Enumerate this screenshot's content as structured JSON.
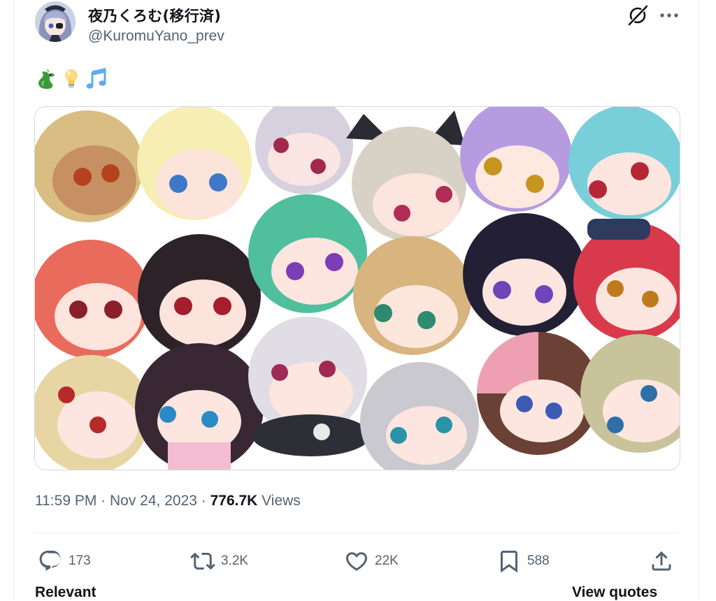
{
  "author": {
    "display_name": "夜乃くろむ(移行済)",
    "handle": "@KuromuYano_prev",
    "avatar_icon": "avatar-image"
  },
  "header_icons": {
    "grok": "grok-icon",
    "more": "more-icon"
  },
  "tweet": {
    "emojis": [
      "dragon-emoji",
      "light-bulb-emoji",
      "music-notes-emoji"
    ],
    "media_description": "chibi-characters-group-illustration"
  },
  "meta": {
    "time": "11:59 PM",
    "separator1": " · ",
    "date": "Nov 24, 2023",
    "separator2": " · ",
    "views_count": "776.7K",
    "views_label": " Views"
  },
  "actions": {
    "replies": "173",
    "reposts": "3.2K",
    "likes": "22K",
    "bookmarks": "588"
  },
  "footer": {
    "left_cut": "Relevant",
    "right_cut": "View quotes"
  },
  "colors": {
    "text_primary": "#0f1419",
    "text_secondary": "#536471",
    "border": "#eff3f4"
  }
}
